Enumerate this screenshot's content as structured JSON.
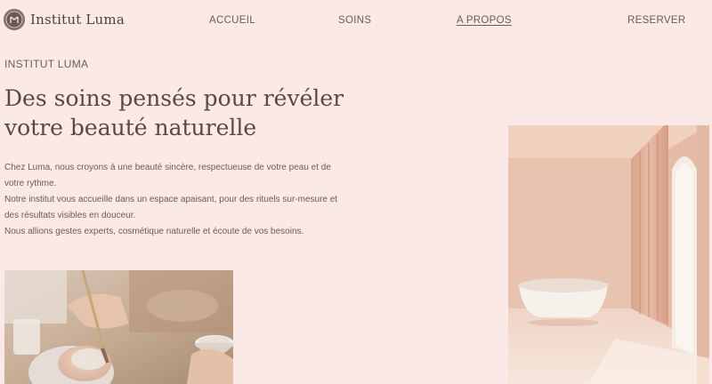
{
  "brand": {
    "name": "Institut Luma",
    "logo_icon": "monogram-logo-icon"
  },
  "nav": {
    "items": [
      {
        "label": "ACCUEIL",
        "active": false
      },
      {
        "label": "SOINS",
        "active": false
      },
      {
        "label": "A PROPOS",
        "active": true
      },
      {
        "label": "RESERVER",
        "active": false
      }
    ]
  },
  "hero": {
    "eyebrow": "INSTITUT LUMA",
    "headline_line1": "Des soins pensés pour révéler",
    "headline_line2": "votre beauté naturelle",
    "paragraph1": "Chez Luma, nous croyons à une beauté sincère, respectueuse de votre peau et de votre rythme.",
    "paragraph2": "Notre institut vous accueille dans un espace apaisant, pour des rituels sur-mesure et des résultats visibles en douceur.",
    "paragraph3": "Nous allions gestes experts, cosmétique naturelle et écoute de vos besoins."
  },
  "colors": {
    "background": "#fbe9e7",
    "text": "#5a4a44",
    "logo": "#6b5a52"
  }
}
